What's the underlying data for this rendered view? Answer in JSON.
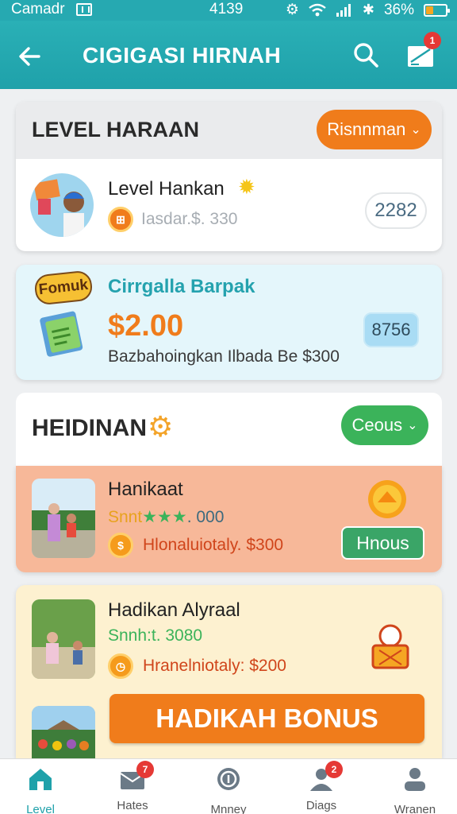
{
  "status_bar": {
    "carrier": "Camadr",
    "time": "4139",
    "battery": "36%",
    "battery_level": 0.36
  },
  "app_bar": {
    "title": "CIGIGASI HIRNAH",
    "message_badge": "1"
  },
  "level_section": {
    "header_title": "LEVEL HARAAN",
    "dropdown_label": "Risnnman",
    "item_title": "Level Hankan",
    "item_subtitle": "Iasdar.$. 330",
    "count": "2282"
  },
  "promo_card": {
    "logo_text": "Fomuk",
    "title": "Cirrgalla Barpak",
    "amount": "$2.00",
    "description": "Bazbahoingkan Ilbada Be $300",
    "count": "8756"
  },
  "reward_section": {
    "header_title": "HEIDINAN",
    "dropdown_label": "Ceous",
    "item1": {
      "title": "Hanikaat",
      "sub_prefix": "Snnt",
      "stars": "★★★",
      "sub_value": ". 000",
      "detail": "Hlonaluiotaly. $300",
      "button_label": "Hnous"
    },
    "item2": {
      "title": "Hadikan Alyraal",
      "sub_value": "Snnh:t. 3080",
      "detail": "Hranelniotaly: $200",
      "button_label": "HADIKAH BONUS"
    }
  },
  "bottom_nav": [
    {
      "label": "Level",
      "icon": "home-icon",
      "active": true
    },
    {
      "label": "Hates",
      "icon": "mail-icon",
      "badge": "7"
    },
    {
      "label": "Mnney",
      "icon": "money-icon"
    },
    {
      "label": "Diags",
      "icon": "users-icon",
      "badge": "2"
    },
    {
      "label": "Wranen",
      "icon": "person-icon"
    }
  ],
  "colors": {
    "teal": "#1fa1aa",
    "orange": "#f07c1b",
    "green": "#3bb35a",
    "salmon": "#f7b899",
    "cream": "#fdf1d0",
    "light_blue": "#e4f6fb"
  }
}
